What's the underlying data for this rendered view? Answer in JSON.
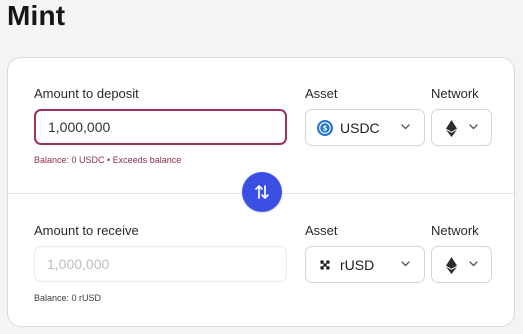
{
  "page": {
    "title": "Mint"
  },
  "deposit": {
    "amount_label": "Amount to deposit",
    "amount_value": "1,000,000",
    "helper_text": "Balance: 0 USDC • Exceeds balance",
    "asset_label": "Asset",
    "asset_value": "USDC",
    "asset_icon": "usdc-coin-icon",
    "network_label": "Network",
    "network_icon": "ethereum-icon"
  },
  "swap": {
    "icon": "swap-arrows-icon"
  },
  "receive": {
    "amount_label": "Amount to receive",
    "amount_placeholder": "1,000,000",
    "helper_text": "Balance: 0 rUSD",
    "asset_label": "Asset",
    "asset_value": "rUSD",
    "asset_icon": "rusd-coin-icon",
    "network_label": "Network",
    "network_icon": "ethereum-icon"
  },
  "colors": {
    "accent": "#3b4fe4",
    "error": "#9b3263",
    "usdc": "#2775ca"
  }
}
